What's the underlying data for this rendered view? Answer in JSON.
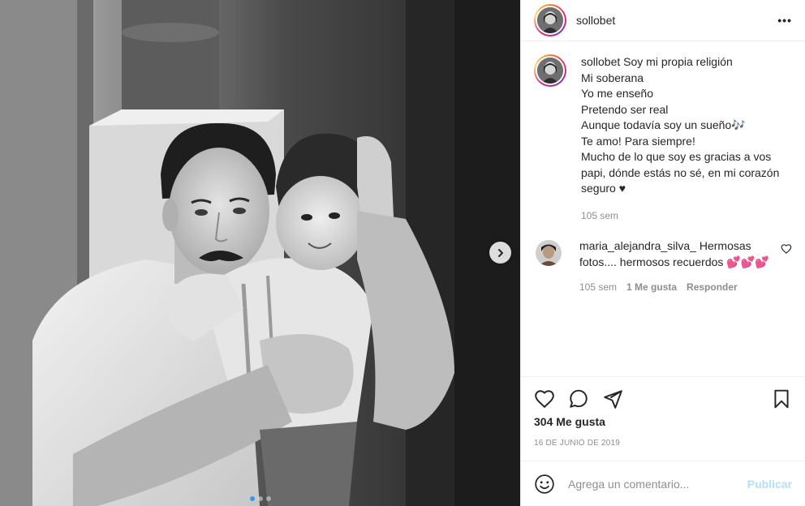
{
  "post": {
    "username": "sollobet",
    "more_glyph": "•••"
  },
  "caption": {
    "username": "sollobet",
    "lines": [
      "Soy mi propia religión",
      "Mi soberana",
      "Yo me enseño",
      "Pretendo ser real",
      "Aunque todavía soy un sueño🎶"
    ],
    "line2": "Te amo! Para siempre!",
    "line3": "Mucho de lo que soy es gracias a vos papi, dónde estás no sé, en mi corazón seguro ♥",
    "time": "105 sem"
  },
  "comment": {
    "username": "maria_alejandra_silva_",
    "text": "Hermosas fotos.... hermosos recuerdos 💕💕💕",
    "time": "105 sem",
    "likes": "1 Me gusta",
    "reply": "Responder"
  },
  "stats": {
    "likes": "304 Me gusta",
    "date": "16 DE JUNIO DE 2019"
  },
  "composer": {
    "placeholder": "Agrega un comentario...",
    "publish": "Publicar"
  },
  "carousel": {
    "total": 3,
    "active": 0
  },
  "icons": {
    "heart": "heart-icon",
    "comment": "comment-icon",
    "share": "share-icon",
    "save": "bookmark-icon",
    "emoji": "emoji-icon",
    "next": "chevron-right-icon"
  },
  "colors": {
    "accent": "#3897f0",
    "publish_disabled": "#b2dffc",
    "muted": "#8e8e8e",
    "text": "#262626"
  }
}
